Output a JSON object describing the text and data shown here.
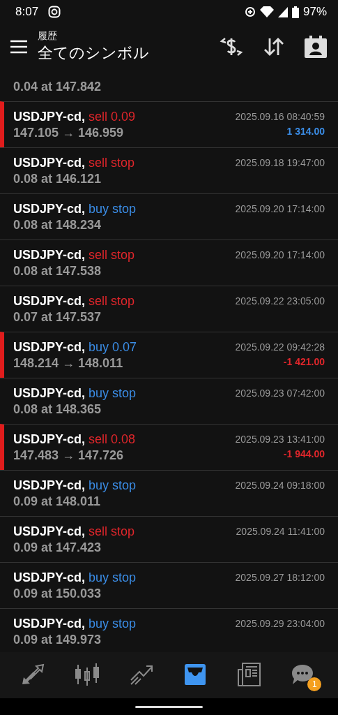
{
  "status_bar": {
    "time": "8:07",
    "battery": "97%"
  },
  "header": {
    "subtitle": "履歴",
    "title": "全てのシンボル"
  },
  "partial_row": {
    "detail": "0.04 at 147.842"
  },
  "rows": [
    {
      "kind": "deal",
      "symbol": "USDJPY-cd,",
      "side": "sell",
      "color": "#e0262b",
      "amount": "0.09",
      "detail": "147.105 → 146.959",
      "time": "2025.09.16 08:40:59",
      "profit": "1 314.00",
      "positive": true
    },
    {
      "kind": "order",
      "symbol": "USDJPY-cd,",
      "side": "sell",
      "color": "#e0262b",
      "amount": "stop",
      "detail": "0.08 at 146.121",
      "time": "2025.09.18 19:47:00"
    },
    {
      "kind": "order",
      "symbol": "USDJPY-cd,",
      "side": "buy",
      "color": "#3b8de6",
      "amount": "stop",
      "detail": "0.08 at 148.234",
      "time": "2025.09.20 17:14:00"
    },
    {
      "kind": "order",
      "symbol": "USDJPY-cd,",
      "side": "sell",
      "color": "#e0262b",
      "amount": "stop",
      "detail": "0.08 at 147.538",
      "time": "2025.09.20 17:14:00"
    },
    {
      "kind": "order",
      "symbol": "USDJPY-cd,",
      "side": "sell",
      "color": "#e0262b",
      "amount": "stop",
      "detail": "0.07 at 147.537",
      "time": "2025.09.22 23:05:00"
    },
    {
      "kind": "deal",
      "symbol": "USDJPY-cd,",
      "side": "buy",
      "color": "#3b8de6",
      "amount": "0.07",
      "detail": "148.214 → 148.011",
      "time": "2025.09.22 09:42:28",
      "profit": "-1 421.00",
      "positive": false
    },
    {
      "kind": "order",
      "symbol": "USDJPY-cd,",
      "side": "buy",
      "color": "#3b8de6",
      "amount": "stop",
      "detail": "0.08 at 148.365",
      "time": "2025.09.23 07:42:00"
    },
    {
      "kind": "deal",
      "symbol": "USDJPY-cd,",
      "side": "sell",
      "color": "#e0262b",
      "amount": "0.08",
      "detail": "147.483 → 147.726",
      "time": "2025.09.23 13:41:00",
      "profit": "-1 944.00",
      "positive": false
    },
    {
      "kind": "order",
      "symbol": "USDJPY-cd,",
      "side": "buy",
      "color": "#3b8de6",
      "amount": "stop",
      "detail": "0.09 at 148.011",
      "time": "2025.09.24 09:18:00"
    },
    {
      "kind": "order",
      "symbol": "USDJPY-cd,",
      "side": "sell",
      "color": "#e0262b",
      "amount": "stop",
      "detail": "0.09 at 147.423",
      "time": "2025.09.24 11:41:00"
    },
    {
      "kind": "order",
      "symbol": "USDJPY-cd,",
      "side": "buy",
      "color": "#3b8de6",
      "amount": "stop",
      "detail": "0.09 at 150.033",
      "time": "2025.09.27 18:12:00"
    },
    {
      "kind": "order",
      "symbol": "USDJPY-cd,",
      "side": "buy",
      "color": "#3b8de6",
      "amount": "stop",
      "detail": "0.09 at 149.973",
      "time": "2025.09.29 23:04:00"
    }
  ],
  "nav": [
    {
      "kind": "trade",
      "selected": false
    },
    {
      "kind": "quotes",
      "selected": false
    },
    {
      "kind": "chart",
      "selected": false
    },
    {
      "kind": "history",
      "selected": true
    },
    {
      "kind": "news",
      "selected": false
    },
    {
      "kind": "chat",
      "selected": false,
      "badge": "1"
    }
  ]
}
